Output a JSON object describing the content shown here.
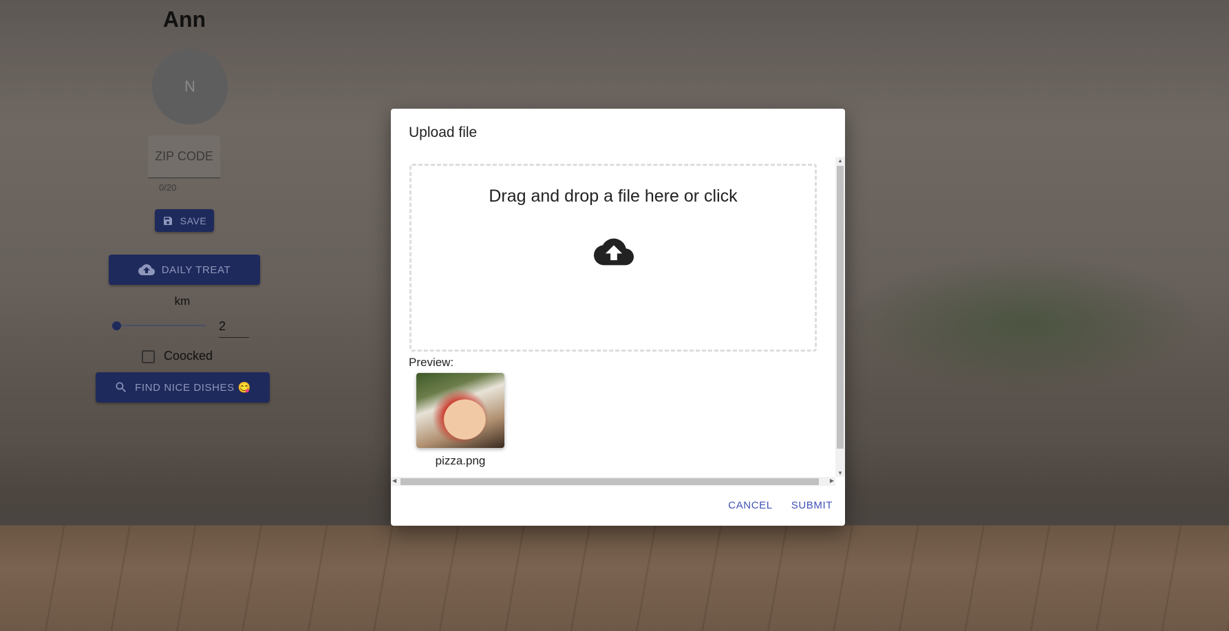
{
  "profile": {
    "name": "Ann",
    "avatar_initial": "N",
    "zip_placeholder": "ZIP CODE",
    "zip_counter": "0/20",
    "save_label": "SAVE"
  },
  "controls": {
    "daily_treat_label": "DAILY TREAT",
    "distance_unit": "km",
    "distance_value": "2",
    "distance_slider_fraction": 0,
    "cooked_label": "Coocked",
    "cooked_checked": false,
    "find_label": "FIND NICE DISHES 😋"
  },
  "dialog": {
    "title": "Upload file",
    "dropzone_text": "Drag and drop a file here or click",
    "preview_label": "Preview:",
    "files": [
      {
        "name": "pizza.png"
      }
    ],
    "cancel_label": "CANCEL",
    "submit_label": "SUBMIT"
  },
  "colors": {
    "primary": "#3f51b5",
    "button_bg": "#1f2a5c"
  }
}
